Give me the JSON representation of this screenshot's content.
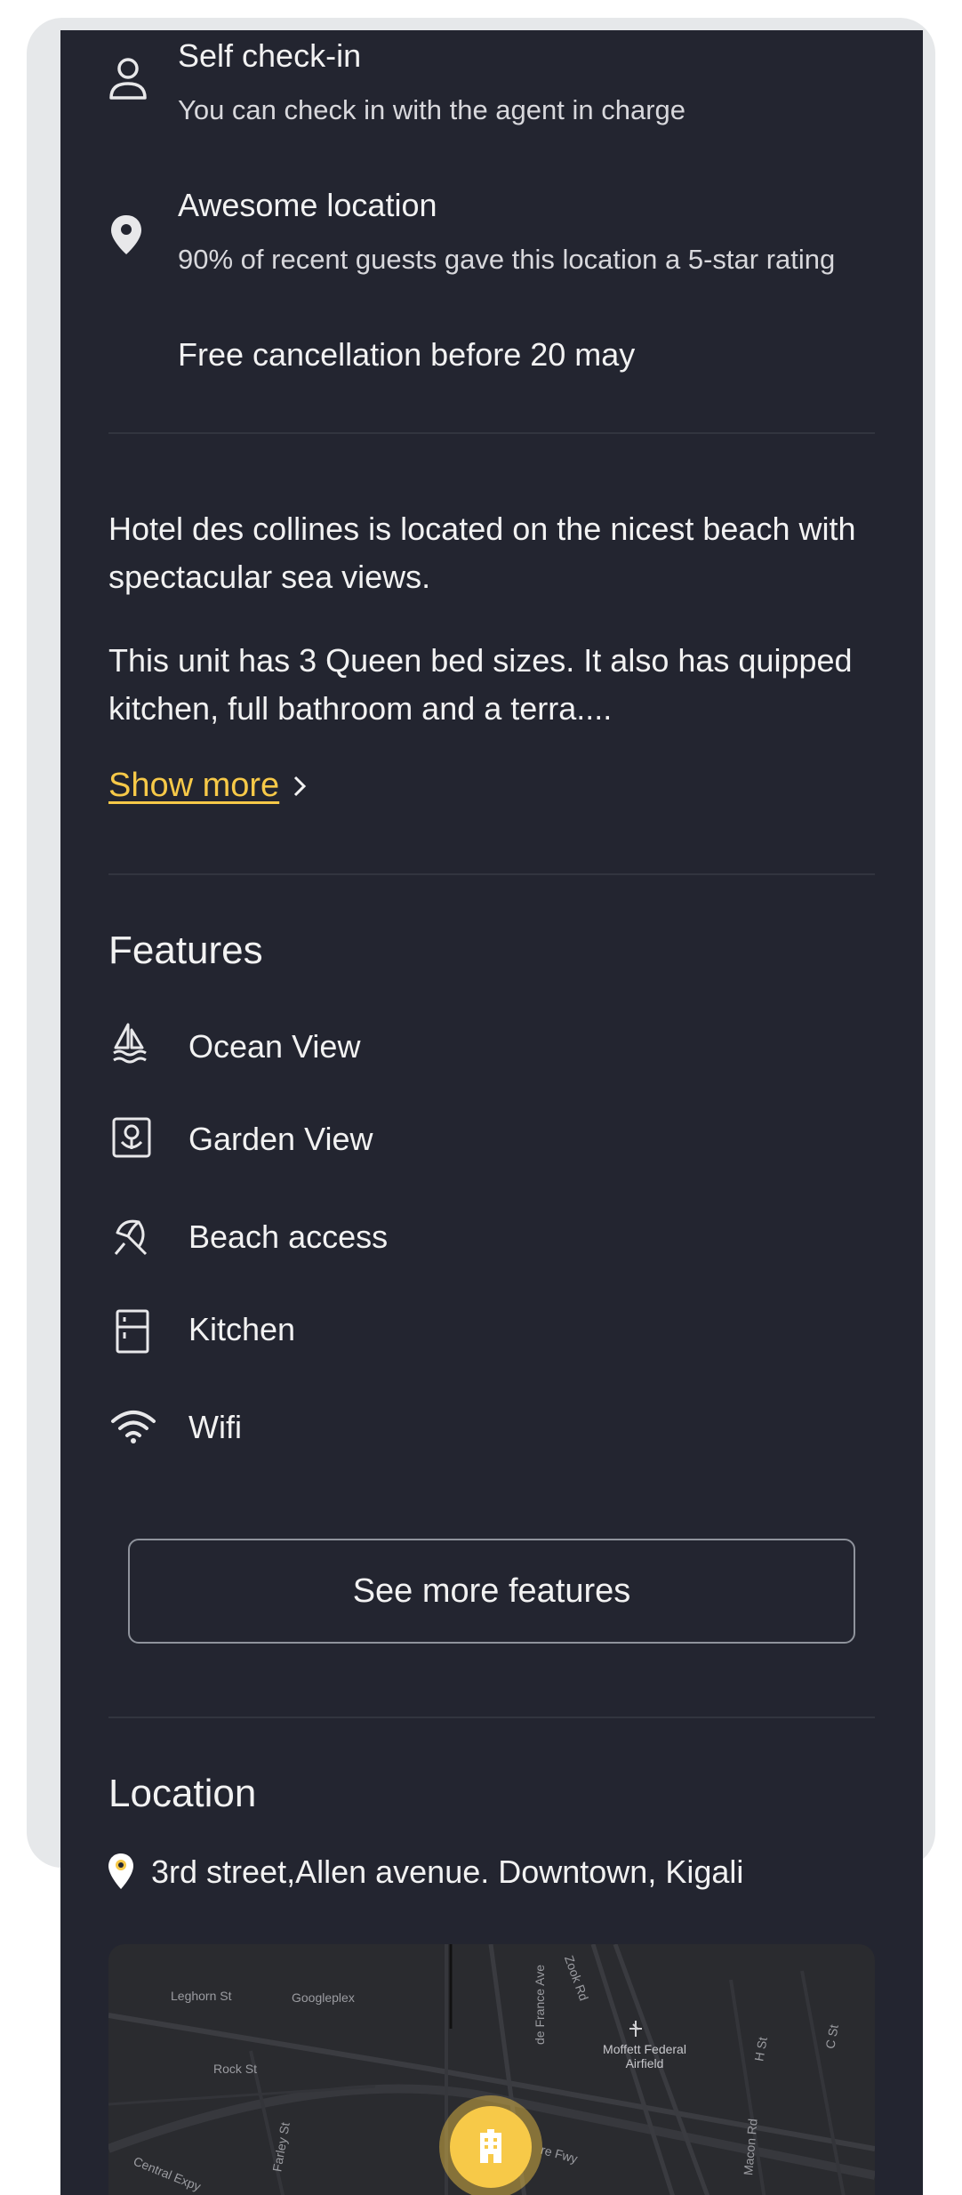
{
  "highlights": [
    {
      "title": "Self check-in",
      "subtitle": "You can check in with the agent in charge",
      "icon": "person-icon"
    },
    {
      "title": "Awesome location",
      "subtitle": "90% of recent guests gave this location a 5-star rating",
      "icon": "location-pin-icon"
    },
    {
      "title": "Free cancellation before 20 may"
    }
  ],
  "description": {
    "paragraph1": "Hotel des collines is located on the nicest beach with spectacular sea views.",
    "paragraph2": "This unit has 3 Queen bed sizes. It also has quipped kitchen, full bathroom and a terra....",
    "show_more": "Show more"
  },
  "features": {
    "title": "Features",
    "items": [
      {
        "label": "Ocean View",
        "icon": "sailboat-icon"
      },
      {
        "label": "Garden View",
        "icon": "flower-icon"
      },
      {
        "label": "Beach access",
        "icon": "umbrella-icon"
      },
      {
        "label": "Kitchen",
        "icon": "fridge-icon"
      },
      {
        "label": "Wifi",
        "icon": "wifi-icon"
      }
    ],
    "see_more": "See more features"
  },
  "location": {
    "title": "Location",
    "address": "3rd street,Allen avenue. Downtown, Kigali",
    "map_labels": [
      "Leghorn St",
      "Googleplex",
      "de France Ave",
      "Zook Rd",
      "Moffett Federal Airfield",
      "H St",
      "C St",
      "Rock St",
      "Farley St",
      "Central Expy",
      "Macon Rd",
      "re Fwy"
    ]
  },
  "colors": {
    "background": "#232530",
    "accent": "#f7c948",
    "text": "#f2f2f2"
  }
}
